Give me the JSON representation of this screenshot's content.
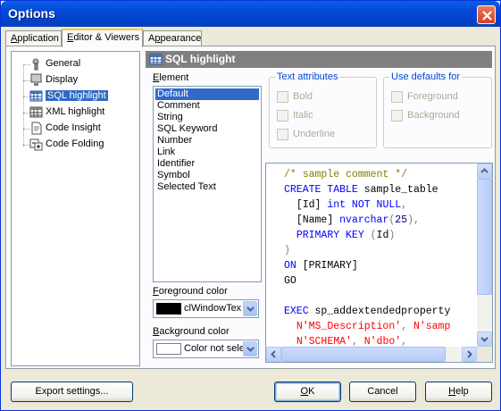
{
  "window": {
    "title": "Options"
  },
  "tabs": [
    {
      "label": "Application",
      "accel": "A",
      "rest": "pplication",
      "active": false
    },
    {
      "label": "Editor & Viewers",
      "accel": "E",
      "rest": "ditor & Viewers",
      "active": true
    },
    {
      "label": "Appearance",
      "accel": "p",
      "pre": "A",
      "rest": "pearance",
      "active": false
    }
  ],
  "tree": {
    "items": [
      {
        "label": "General",
        "icon": "wrench-icon",
        "selected": false
      },
      {
        "label": "Display",
        "icon": "monitor-icon",
        "selected": false
      },
      {
        "label": "SQL highlight",
        "icon": "grid-icon",
        "selected": true
      },
      {
        "label": "XML highlight",
        "icon": "xml-icon",
        "selected": false
      },
      {
        "label": "Code Insight",
        "icon": "document-icon",
        "selected": false
      },
      {
        "label": "Code Folding",
        "icon": "fold-icon",
        "selected": false
      }
    ]
  },
  "section": {
    "title": "SQL highlight"
  },
  "element": {
    "label": "Element",
    "accel": "E",
    "items": [
      "Default",
      "Comment",
      "String",
      "SQL Keyword",
      "Number",
      "Link",
      "Identifier",
      "Symbol",
      "Selected Text"
    ],
    "selected_index": 0
  },
  "text_attributes": {
    "legend": "Text attributes",
    "bold": "Bold",
    "italic": "Italic",
    "underline": "Underline"
  },
  "use_defaults": {
    "legend": "Use defaults for",
    "foreground": "Foreground",
    "background": "Background"
  },
  "foreground_color": {
    "label": "Foreground color",
    "accel": "F",
    "value": "clWindowTex",
    "swatch": "#000000"
  },
  "background_color": {
    "label": "Background color",
    "accel": "B",
    "value": "Color not sele",
    "swatch": "#FFFFFF"
  },
  "code_preview": {
    "lines": [
      "/* sample comment */",
      "CREATE TABLE sample_table",
      "  [Id] int NOT NULL,",
      "  [Name] nvarchar(25),",
      "  PRIMARY KEY (Id)",
      ")",
      "ON [PRIMARY]",
      "GO",
      "",
      "EXEC sp_addextendedproperty",
      "  N'MS_Description', N'samp",
      "  N'SCHEMA', N'dbo',"
    ]
  },
  "buttons": {
    "export": "Export settings...",
    "ok": "OK",
    "ok_accel": "O",
    "cancel": "Cancel",
    "help": "Help",
    "help_accel": "H"
  }
}
